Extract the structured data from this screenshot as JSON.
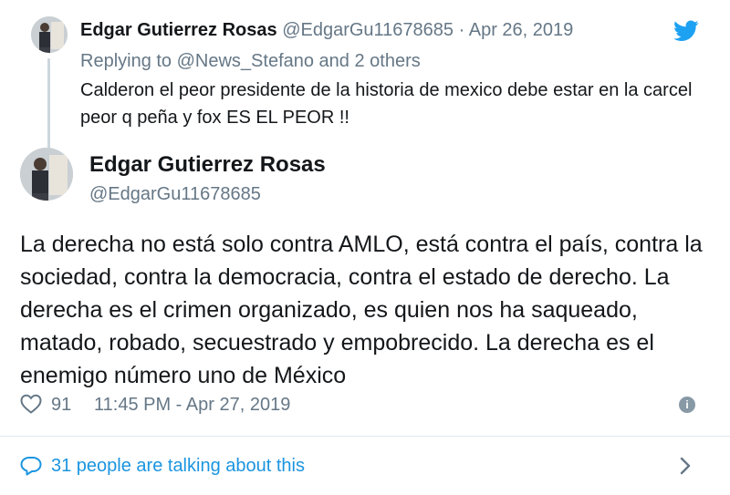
{
  "reply": {
    "name": "Edgar Gutierrez Rosas",
    "handle": "@EdgarGu11678685",
    "separator": "·",
    "date": "Apr 26, 2019",
    "replying_to": "Replying to @News_Stefano and 2 others",
    "text": "Calderon el peor presidente de la historia de mexico debe estar en la carcel peor q peña y fox ES EL PEOR !!"
  },
  "main": {
    "name": "Edgar Gutierrez Rosas",
    "handle": "@EdgarGu11678685",
    "text": "La derecha no está solo contra AMLO, está contra el país, contra la sociedad, contra la democracia, contra el estado de derecho. La derecha es el crimen organizado, es quien nos ha saqueado, matado, robado, secuestrado y empobrecido. La derecha es el enemigo número uno de México"
  },
  "stats": {
    "likes": "91",
    "timestamp": "11:45 PM - Apr 27, 2019",
    "info_glyph": "i"
  },
  "conversation": {
    "label": "31 people are talking about this"
  },
  "icons": {
    "brand": "twitter-bird-icon",
    "like": "heart-icon",
    "info": "info-icon",
    "conversation": "speech-bubble-icon",
    "more": "chevron-right-icon"
  },
  "colors": {
    "brand_blue": "#1da1f2",
    "link_blue": "#1b95e0",
    "secondary_text": "#657786",
    "primary_text": "#14171a",
    "thread_line": "#ccd6dd"
  }
}
